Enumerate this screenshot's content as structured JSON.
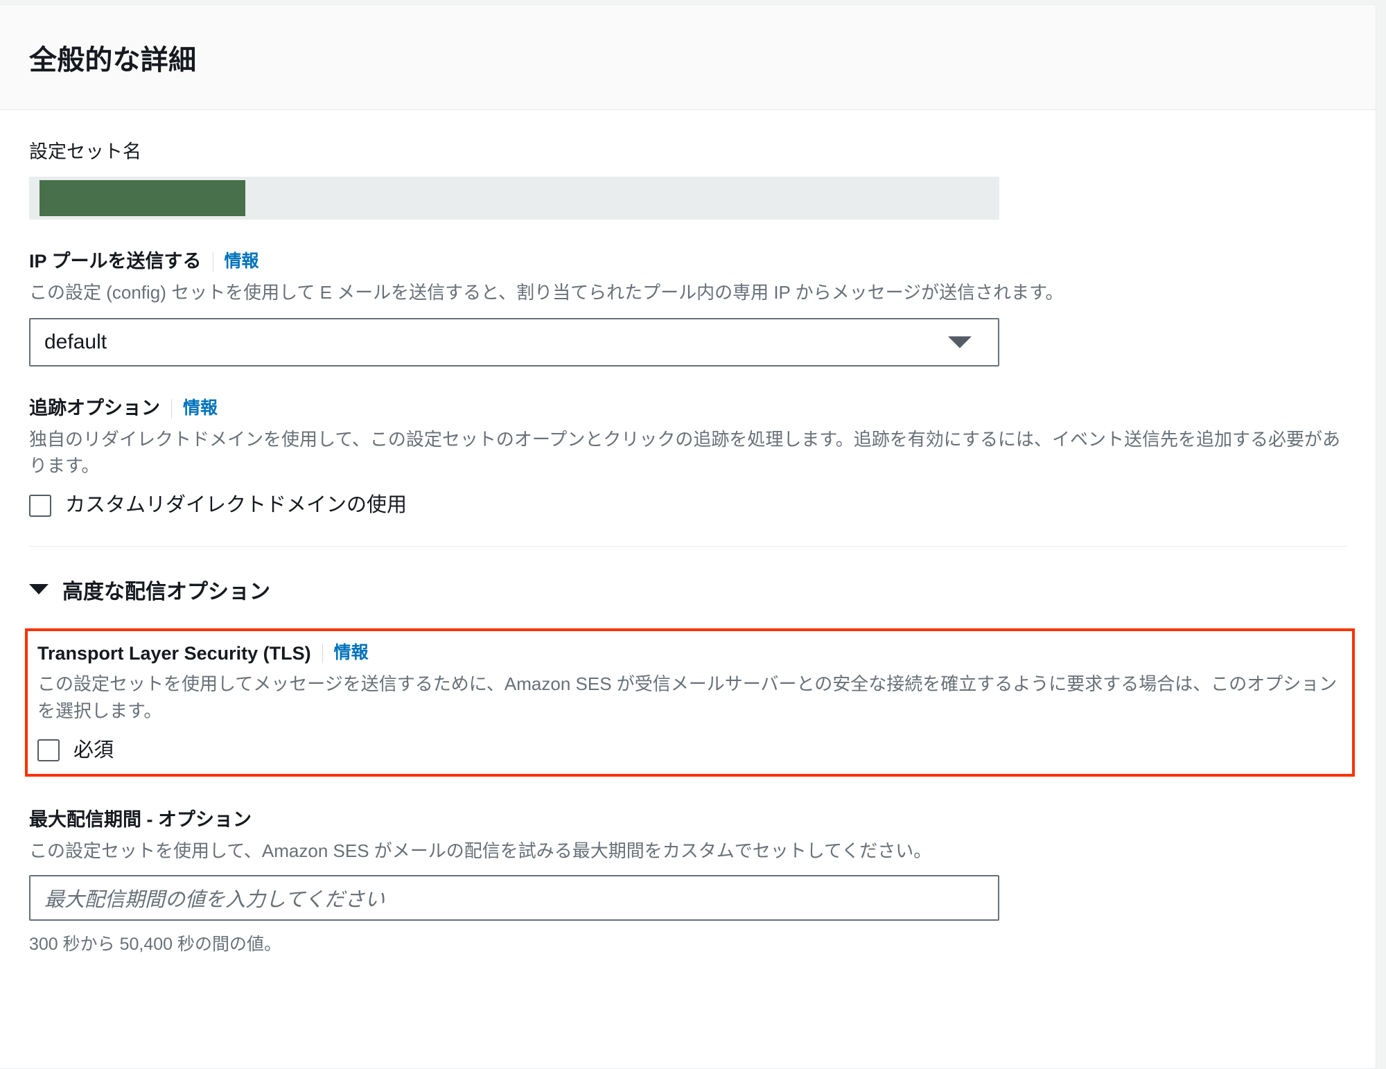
{
  "header": {
    "title": "全般的な詳細"
  },
  "config_set_name": {
    "label": "設定セット名",
    "value_redacted": true,
    "redaction_color": "#47704b"
  },
  "sending_ip_pool": {
    "label": "IP プールを送信する",
    "info_label": "情報",
    "description": "この設定 (config) セットを使用して E メールを送信すると、割り当てられたプール内の専用 IP からメッセージが送信されます。",
    "selected_value": "default",
    "options": [
      "default"
    ],
    "arrow_icon": "chevron-down-icon"
  },
  "tracking_options": {
    "label": "追跡オプション",
    "info_label": "情報",
    "description": "独自のリダイレクトドメインを使用して、この設定セットのオープンとクリックの追跡を処理します。追跡を有効にするには、イベント送信先を追加する必要があります。",
    "checkbox_label": "カスタムリダイレクトドメインの使用",
    "checked": false
  },
  "advanced_delivery": {
    "section_title": "高度な配信オプション",
    "expanded": true,
    "caret_icon": "caret-down-icon"
  },
  "tls": {
    "label": "Transport Layer Security (TLS)",
    "info_label": "情報",
    "description": "この設定セットを使用してメッセージを送信するために、Amazon SES が受信メールサーバーとの安全な接続を確立するように要求する場合は、このオプションを選択します。",
    "checkbox_label": "必須",
    "checked": false,
    "highlight_color": "#fa3202"
  },
  "max_delivery": {
    "label": "最大配信期間 - オプション",
    "description": "この設定セットを使用して、Amazon SES がメールの配信を試みる最大期間をカスタムでセットしてください。",
    "placeholder": "最大配信期間の値を入力してください",
    "value": "",
    "constraint": "300 秒から 50,400 秒の間の値。"
  }
}
